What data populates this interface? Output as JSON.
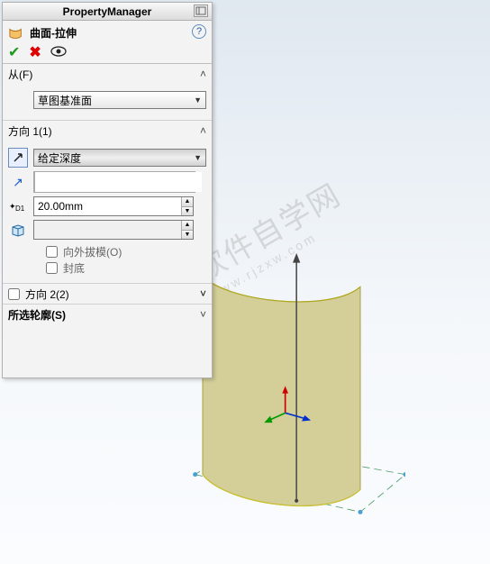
{
  "header": {
    "title": "PropertyManager"
  },
  "feature": {
    "title": "曲面-拉伸",
    "help_label": "?"
  },
  "sections": {
    "from": {
      "label": "从(F)",
      "dropdown_value": "草图基准面"
    },
    "direction1": {
      "label": "方向 1(1)",
      "end_condition": "给定深度",
      "depth": "20.00mm",
      "draft_label": "向外拔模(O)",
      "draft_checked": false,
      "cap_label": "封底",
      "cap_checked": false
    },
    "direction2": {
      "label": "方向 2(2)",
      "checked": false
    },
    "contours": {
      "label": "所选轮廓(S)"
    }
  },
  "watermark": {
    "main": "软件自学网",
    "sub": "www.rjzxw.com"
  }
}
